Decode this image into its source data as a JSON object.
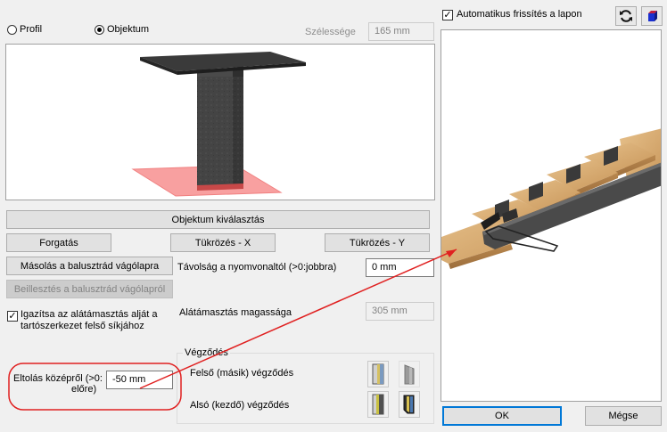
{
  "mode": {
    "options": [
      {
        "label": "Profil",
        "checked": false
      },
      {
        "label": "Objektum",
        "checked": true
      }
    ]
  },
  "width_field": {
    "label": "Szélessége",
    "value": "165 mm"
  },
  "buttons": {
    "select_object": "Objektum kiválasztás",
    "rotate": "Forgatás",
    "mirror_x": "Tükrözés - X",
    "mirror_y": "Tükrözés - Y",
    "copy": "Másolás a balusztrád vágólapra",
    "paste": "Beillesztés a balusztrád vágólapról",
    "ok": "OK",
    "cancel": "Mégse"
  },
  "distance_field": {
    "label": "Távolság a nyomvonaltól (>0:jobbra)",
    "value": "0 mm"
  },
  "align_checkbox": {
    "label_line1": "Igazítsa az alátámasztás alját a",
    "label_line2": "tartószerkezet felső síkjához",
    "checked": true
  },
  "height_field": {
    "label": "Alátámasztás magassága",
    "value": "305 mm"
  },
  "offset_field": {
    "label_line1": "Eltolás középről (>0:",
    "label_line2": "előre)",
    "value": "-50 mm"
  },
  "ending_group": {
    "title": "Végződés",
    "upper_label": "Felső (másik) végződés",
    "lower_label": "Alsó (kezdő) végződés"
  },
  "auto_refresh": {
    "label": "Automatikus frissítés a lapon",
    "checked": true
  },
  "colors": {
    "annotation_red": "#e02020",
    "footprint_red": "#f8a0a0"
  }
}
